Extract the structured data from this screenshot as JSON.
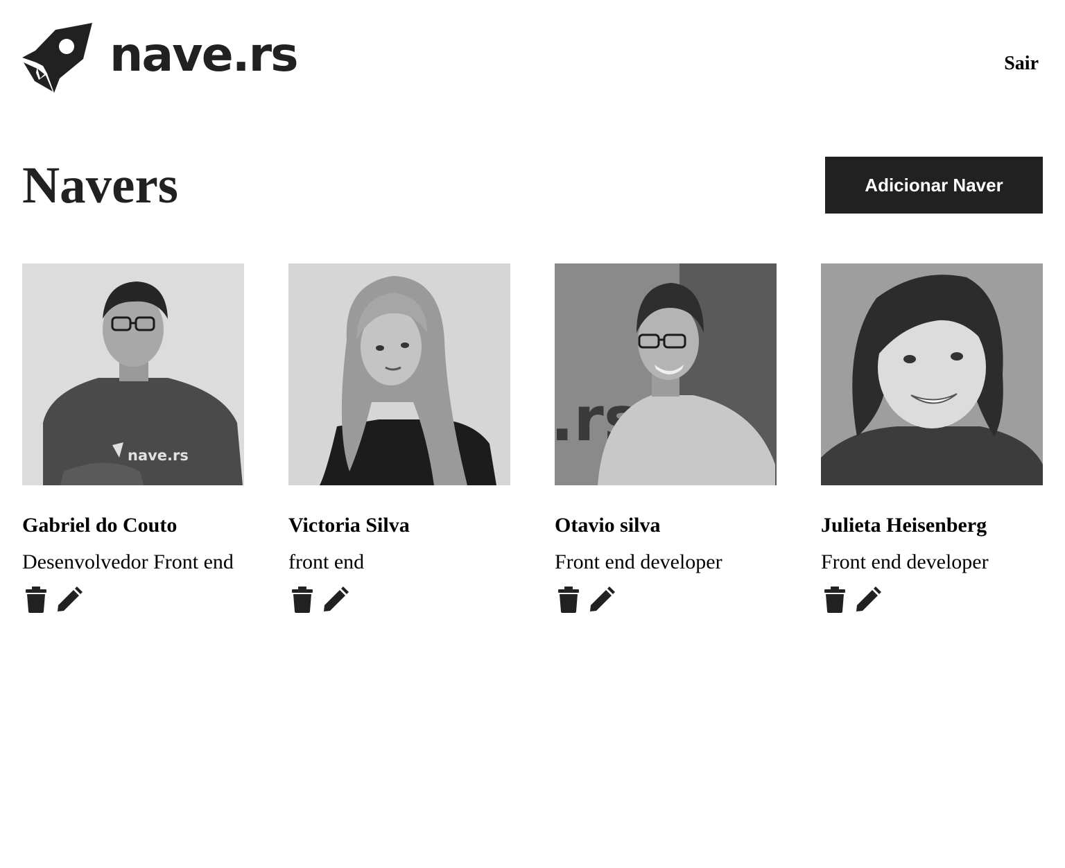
{
  "header": {
    "brand": "nave.rs",
    "logout_label": "Sair"
  },
  "main": {
    "title": "Navers",
    "add_button_label": "Adicionar Naver"
  },
  "navers": [
    {
      "name": "Gabriel do Couto",
      "job_role": "Desenvolvedor Front end",
      "photo_icon": "person-photo"
    },
    {
      "name": "Victoria Silva",
      "job_role": "front end",
      "photo_icon": "person-photo"
    },
    {
      "name": "Otavio silva",
      "job_role": "Front end developer",
      "photo_icon": "person-photo"
    },
    {
      "name": "Julieta Heisenberg",
      "job_role": "Front end developer",
      "photo_icon": "person-photo"
    }
  ],
  "icons": {
    "delete": "trash-icon",
    "edit": "pencil-icon"
  },
  "colors": {
    "primary": "#212121",
    "background": "#ffffff",
    "text": "#000000"
  }
}
